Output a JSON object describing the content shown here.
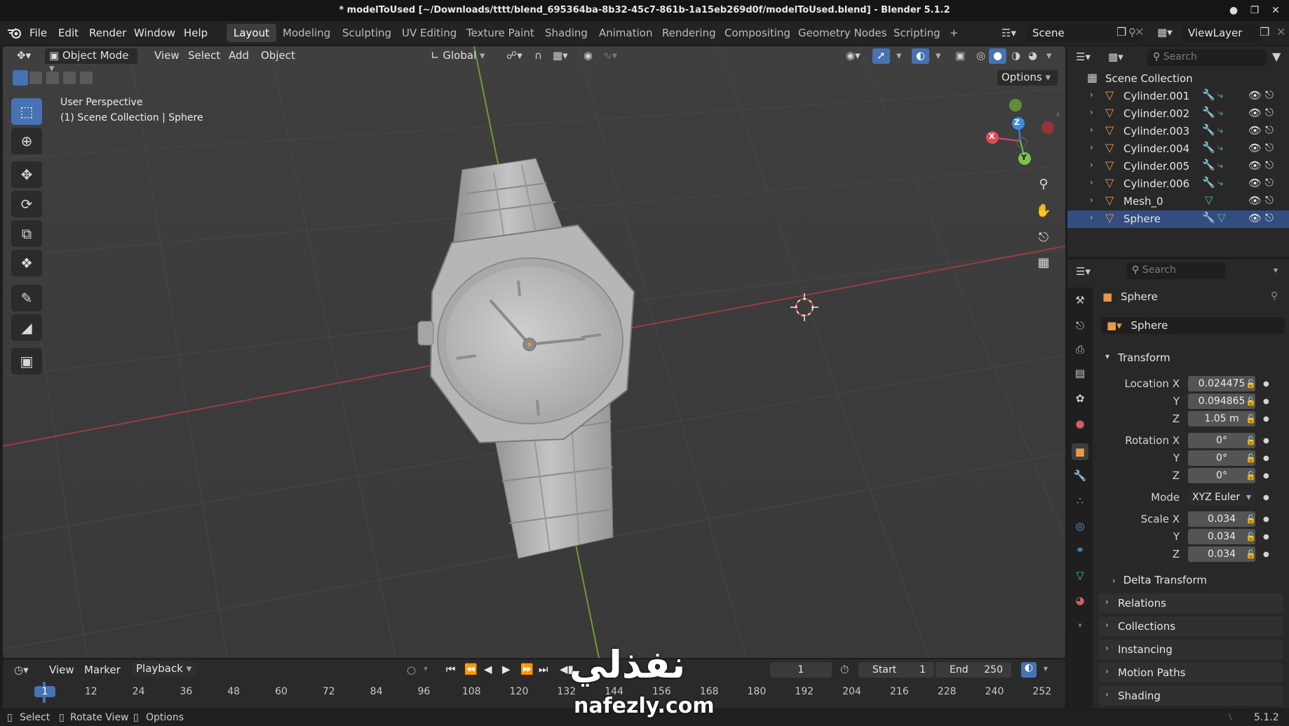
{
  "window": {
    "title": "* modelToUsed [~/Downloads/tttt/blend_695364ba-8b32-45c7-861b-1a15eb269d0f/modelToUsed.blend] - Blender 5.1.2",
    "controls": [
      "●",
      "❐",
      "✕"
    ]
  },
  "menubar": {
    "menus": [
      "File",
      "Edit",
      "Render",
      "Window",
      "Help"
    ],
    "workspaces": [
      "Layout",
      "Modeling",
      "Sculpting",
      "UV Editing",
      "Texture Paint",
      "Shading",
      "Animation",
      "Rendering",
      "Compositing",
      "Geometry Nodes",
      "Scripting"
    ],
    "active_workspace": "Layout",
    "add_tab": "+",
    "scene": "Scene",
    "view_layer": "ViewLayer"
  },
  "viewport": {
    "mode": "Object Mode",
    "header_menus": [
      "View",
      "Select",
      "Add",
      "Object"
    ],
    "transform_orientation": "Global",
    "options_label": "Options",
    "perspective_label": "User Perspective",
    "collection_label": "(1) Scene Collection | Sphere",
    "gizmo_axes": {
      "x": "X",
      "y": "Y",
      "z": "Z"
    },
    "axis_colors": {
      "x": "#e04a57",
      "y": "#7cc34a",
      "z": "#3d8be0"
    }
  },
  "outliner": {
    "search_placeholder": "Search",
    "root": "Scene Collection",
    "items": [
      {
        "name": "Cylinder.001",
        "has_modifier": true,
        "data": "curve"
      },
      {
        "name": "Cylinder.002",
        "has_modifier": true,
        "data": "curve"
      },
      {
        "name": "Cylinder.003",
        "has_modifier": true,
        "data": "curve"
      },
      {
        "name": "Cylinder.004",
        "has_modifier": true,
        "data": "curve"
      },
      {
        "name": "Cylinder.005",
        "has_modifier": true,
        "data": "curve"
      },
      {
        "name": "Cylinder.006",
        "has_modifier": true,
        "data": "curve"
      },
      {
        "name": "Mesh_0",
        "has_modifier": false,
        "data": "mesh"
      },
      {
        "name": "Sphere",
        "has_modifier": true,
        "data": "mesh"
      }
    ]
  },
  "properties": {
    "search_placeholder": "Search",
    "object_name": "Sphere",
    "object_datablock": "Sphere",
    "transform_header": "Transform",
    "location": {
      "label": "Location X",
      "x": "0.024475",
      "y": "0.094865",
      "z": "1.05 m"
    },
    "rotation": {
      "label": "Rotation X",
      "x": "0°",
      "y": "0°",
      "z": "0°"
    },
    "mode_label": "Mode",
    "mode_value": "XYZ Euler",
    "scale": {
      "label": "Scale X",
      "x": "0.034",
      "y": "0.034",
      "z": "0.034"
    },
    "axis_y": "Y",
    "axis_z": "Z",
    "subpanels": [
      "Delta Transform"
    ],
    "panels": [
      "Relations",
      "Collections",
      "Instancing",
      "Motion Paths",
      "Shading"
    ]
  },
  "timeline": {
    "menus": [
      "View",
      "Marker",
      "Playback"
    ],
    "current_frame": "1",
    "start_label": "Start",
    "start_value": "1",
    "end_label": "End",
    "end_value": "250",
    "ticks": [
      "1",
      "12",
      "24",
      "36",
      "48",
      "60",
      "72",
      "84",
      "96",
      "108",
      "120",
      "132",
      "144",
      "156",
      "168",
      "180",
      "192",
      "204",
      "216",
      "228",
      "240",
      "252"
    ]
  },
  "statusbar": {
    "items": [
      "Select",
      "Rotate View",
      "Options"
    ],
    "version": "5.1.2"
  },
  "watermark": {
    "arabic": "نفذلي",
    "latin": "nafezly.com"
  }
}
